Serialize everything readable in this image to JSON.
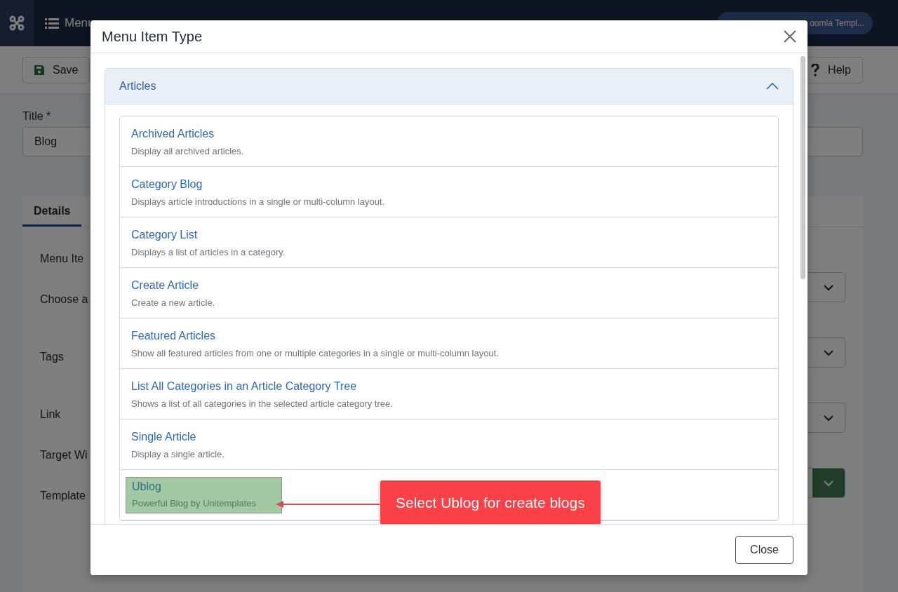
{
  "topbar": {
    "title": "Menu",
    "user": "oomla Templ..."
  },
  "toolbar": [
    {
      "label": "Save",
      "kind": "save"
    },
    {
      "label": "Help",
      "kind": "help"
    }
  ],
  "title_field": {
    "label": "Title *",
    "value": "Blog"
  },
  "tabs": [
    {
      "label": "Details",
      "selected": true
    }
  ],
  "form_labels": [
    "Menu Ite",
    "Choose a",
    "Tags",
    "Link",
    "Target Wi",
    "Template"
  ],
  "selects": [
    {
      "kind": "plain"
    },
    {
      "kind": "plain"
    },
    {
      "kind": "plain"
    },
    {
      "kind": "success"
    }
  ],
  "modal": {
    "title": "Menu Item Type",
    "group": {
      "title": "Articles",
      "expanded": true,
      "items": [
        {
          "title": "Archived Articles",
          "description": "Display all archived articles.",
          "selected": false
        },
        {
          "title": "Category Blog",
          "description": "Displays article introductions in a single or multi-column layout.",
          "selected": false
        },
        {
          "title": "Category List",
          "description": "Displays a list of articles in a category.",
          "selected": false
        },
        {
          "title": "Create Article",
          "description": "Create a new article.",
          "selected": false
        },
        {
          "title": "Featured Articles",
          "description": "Show all featured articles from one or multiple categories in a single or multi-column layout.",
          "selected": false
        },
        {
          "title": "List All Categories in an Article Category Tree",
          "description": "Shows a list of all categories in the selected article category tree.",
          "selected": false
        },
        {
          "title": "Single Article",
          "description": "Display a single article.",
          "selected": false
        },
        {
          "title": "Ublog",
          "description": "Powerful Blog by Unitemplates",
          "selected": true
        }
      ]
    },
    "close_button": "Close"
  },
  "callout": {
    "text": "Select Ublog for create blogs"
  }
}
